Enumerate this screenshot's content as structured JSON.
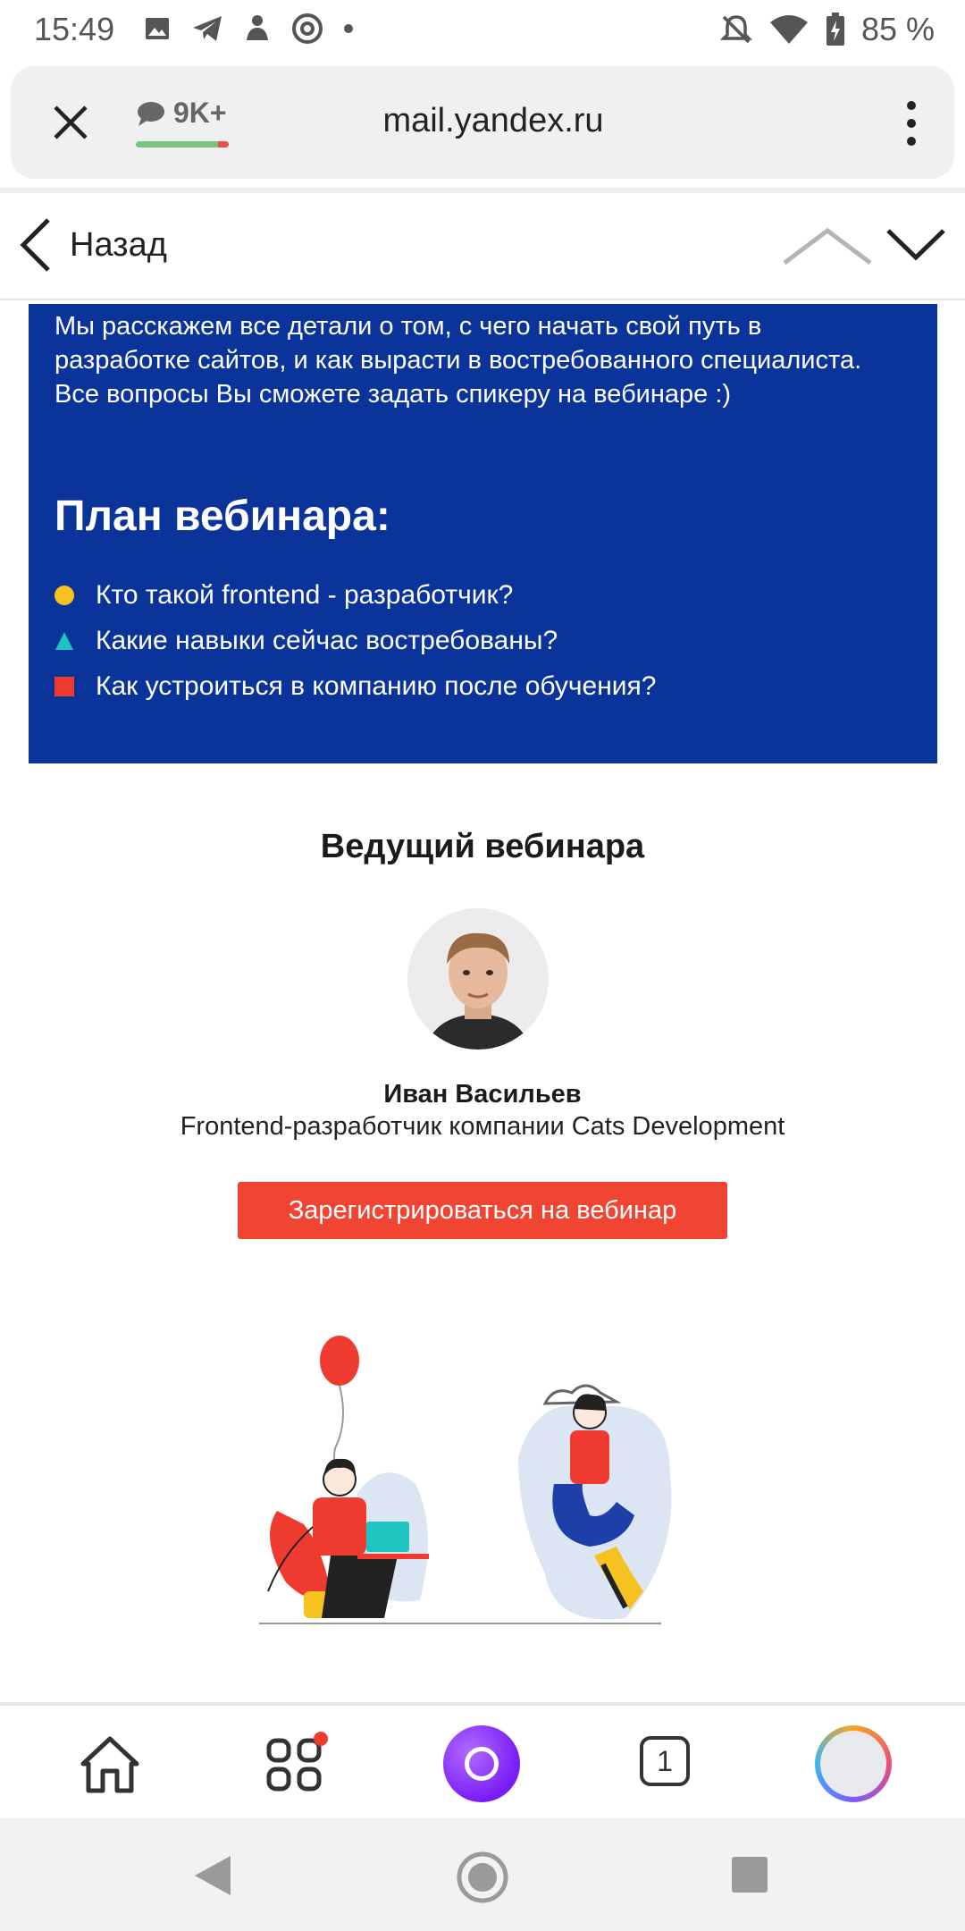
{
  "status_bar": {
    "time": "15:49",
    "battery": "85 %"
  },
  "browser": {
    "comments_count": "9K+",
    "url": "mail.yandex.ru"
  },
  "mail_nav": {
    "back_label": "Назад"
  },
  "promo": {
    "intro_text": "Мы расскажем все детали о том, с чего начать свой путь в разработке сайтов, и как вырасти в востребованного специалиста. Все вопросы Вы сможете задать спикеру на вебинаре :)",
    "plan_title": "План вебинара:",
    "plan_items": [
      {
        "text": "Кто такой frontend - разработчик?",
        "color": "#f6c21f",
        "shape": "circle"
      },
      {
        "text": "Какие навыки сейчас востребованы?",
        "color": "#1ec4c0",
        "shape": "triangle"
      },
      {
        "text": "Как устроиться в компанию после обучения?",
        "color": "#ef3a2f",
        "shape": "square"
      }
    ],
    "background_color": "#0b349a"
  },
  "host": {
    "section_title": "Ведущий вебинара",
    "name": "Иван Васильев",
    "role": "Frontend-разработчик компании Cats Development",
    "register_button": "Зарегистрироваться на вебинар",
    "button_color": "#f04532"
  },
  "bottom_nav": {
    "tabs_count": "1"
  },
  "icons": [
    "image-icon",
    "telegram-icon",
    "notification-icon",
    "at-icon",
    "mute-icon",
    "wifi-icon",
    "battery-icon",
    "close-icon",
    "comment-icon",
    "more-icon",
    "chevron-left-icon",
    "chevron-up-icon",
    "chevron-down-icon",
    "home-icon",
    "services-icon",
    "alice-icon",
    "tabs-icon",
    "profile-icon"
  ]
}
